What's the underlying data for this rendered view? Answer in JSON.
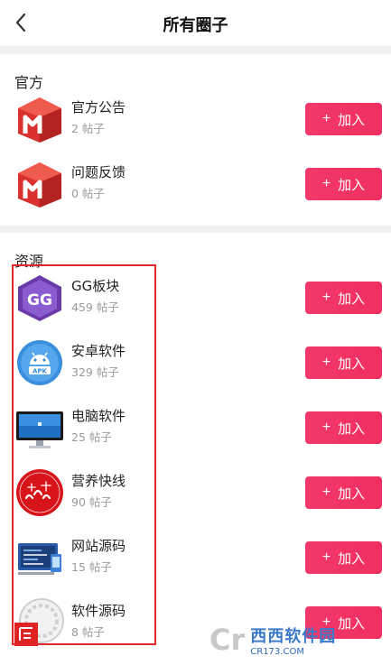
{
  "header": {
    "title": "所有圈子"
  },
  "sections": [
    {
      "title": "官方",
      "items": [
        {
          "name": "官方公告",
          "count": "2 帖子",
          "join_label": "加入",
          "icon": "red-m-logo-icon"
        },
        {
          "name": "问题反馈",
          "count": "0 帖子",
          "join_label": "加入",
          "icon": "red-m-logo-icon"
        }
      ]
    },
    {
      "title": "资源",
      "items": [
        {
          "name": "GG板块",
          "count": "459 帖子",
          "join_label": "加入",
          "icon": "gg-logo-icon"
        },
        {
          "name": "安卓软件",
          "count": "329 帖子",
          "join_label": "加入",
          "icon": "android-apk-icon"
        },
        {
          "name": "电脑软件",
          "count": "25 帖子",
          "join_label": "加入",
          "icon": "monitor-icon"
        },
        {
          "name": "营养快线",
          "count": "90 帖子",
          "join_label": "加入",
          "icon": "fuli-badge-icon"
        },
        {
          "name": "网站源码",
          "count": "15 帖子",
          "join_label": "加入",
          "icon": "website-code-icon"
        },
        {
          "name": "软件源码",
          "count": "8 帖子",
          "join_label": "加入",
          "icon": "source-seal-icon"
        }
      ]
    }
  ],
  "watermark": {
    "logo": "Cr",
    "text": "西西软件园",
    "url": "CR173.COM"
  },
  "colors": {
    "accent": "#f2386b",
    "highlight_box": "#e3262b"
  }
}
